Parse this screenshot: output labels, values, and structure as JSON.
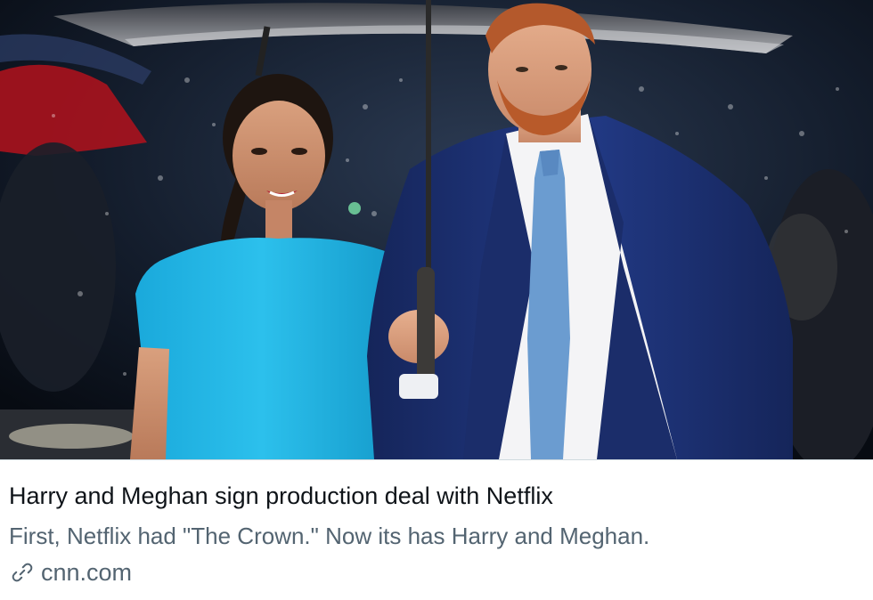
{
  "card": {
    "image": {
      "subject": "two people walking under a black umbrella in the rain"
    },
    "headline": "Harry and Meghan sign production deal with Netflix",
    "description": "First, Netflix had \"The Crown.\" Now its has Harry and Meghan.",
    "source_icon": "link-icon",
    "domain": "cnn.com"
  },
  "colors": {
    "headline_text": "#0f1419",
    "secondary_text": "#536471",
    "dress_blue": "#22b3e3",
    "suit_navy": "#1a2e6e",
    "tie_blue": "#6b9cd0",
    "divider": "#cfd9de"
  }
}
